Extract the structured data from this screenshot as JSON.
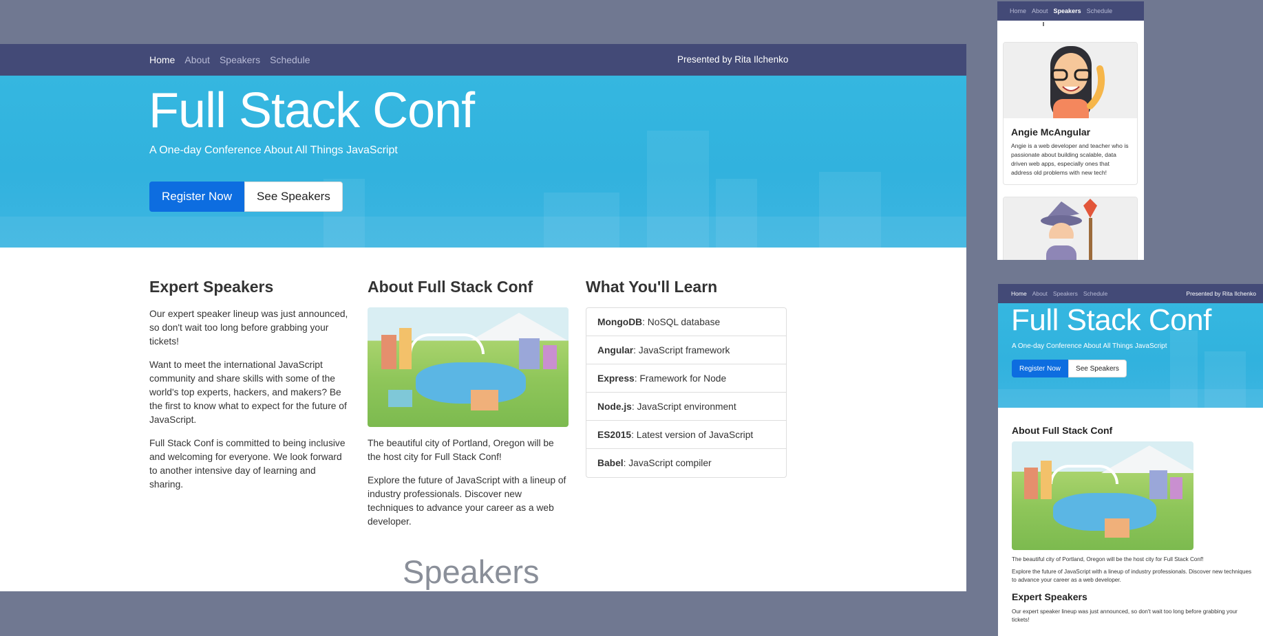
{
  "nav": {
    "links": [
      {
        "label": "Home",
        "active": true
      },
      {
        "label": "About",
        "active": false
      },
      {
        "label": "Speakers",
        "active": false
      },
      {
        "label": "Schedule",
        "active": false
      }
    ],
    "presented_by": "Presented by Rita Ilchenko"
  },
  "hero": {
    "title": "Full Stack Conf",
    "subtitle": "A One-day Conference About All Things JavaScript",
    "register_label": "Register Now",
    "speakers_label": "See Speakers"
  },
  "expert": {
    "heading": "Expert Speakers",
    "p1": "Our expert speaker lineup was just announced, so don't wait too long before grabbing your tickets!",
    "p2": "Want to meet the international JavaScript community and share skills with some of the world's top experts, hackers, and makers? Be the first to know what to expect for the future of JavaScript.",
    "p3": "Full Stack Conf is committed to being inclusive and welcoming for everyone. We look forward to another intensive day of learning and sharing."
  },
  "about": {
    "heading": "About Full Stack Conf",
    "p1": "The beautiful city of Portland, Oregon will be the host city for Full Stack Conf!",
    "p2": "Explore the future of JavaScript with a lineup of industry professionals. Discover new techniques to advance your career as a web developer."
  },
  "learn": {
    "heading": "What You'll Learn",
    "items": [
      {
        "term": "MongoDB",
        "desc": ": NoSQL database"
      },
      {
        "term": "Angular",
        "desc": ": JavaScript framework"
      },
      {
        "term": "Express",
        "desc": ": Framework for Node"
      },
      {
        "term": "Node.js",
        "desc": ": JavaScript environment"
      },
      {
        "term": "ES2015",
        "desc": ": Latest version of JavaScript"
      },
      {
        "term": "Babel",
        "desc": ": JavaScript compiler"
      }
    ]
  },
  "speakers_section": {
    "heading": "Speakers"
  },
  "mobile": {
    "nav_links": [
      {
        "label": "Home",
        "active": false
      },
      {
        "label": "About",
        "active": false
      },
      {
        "label": "Speakers",
        "active": true
      },
      {
        "label": "Schedule",
        "active": false
      }
    ],
    "speaker": {
      "name": "Angie McAngular",
      "bio": "Angie is a web developer and teacher who is passionate about building scalable, data driven web apps, especially ones that address old problems with new tech!"
    }
  },
  "colors": {
    "background": "#707891",
    "nav": "#434a77",
    "hero": "#35b7e0",
    "primary_button": "#0d6de0"
  },
  "icons": [
    "city-illustration",
    "speaker-portrait-angie",
    "speaker-portrait-wizard"
  ]
}
